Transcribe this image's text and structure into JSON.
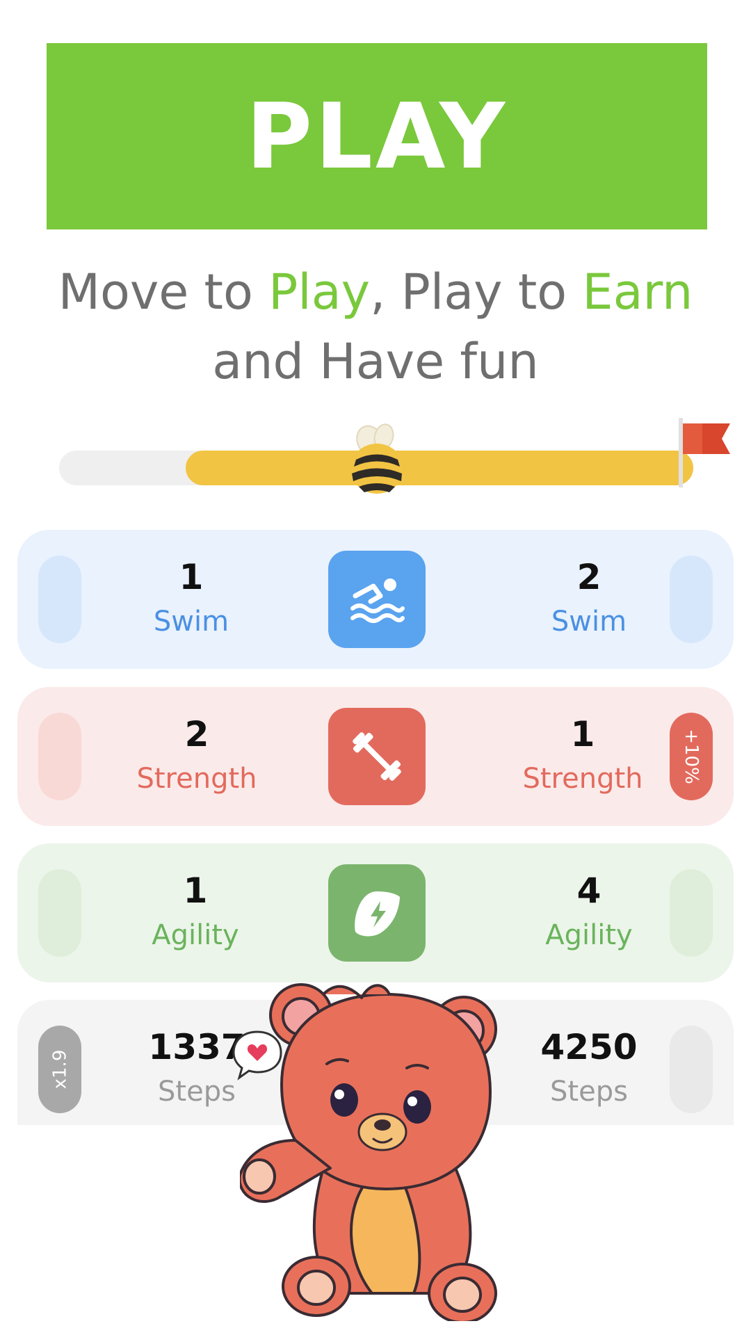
{
  "play_button": {
    "label": "PLAY"
  },
  "tagline": {
    "part1": "Move to ",
    "play": "Play",
    "part2": ", Play to ",
    "earn": "Earn",
    "line2": "and Have fun"
  },
  "progress": {
    "start_fraction": 0.2,
    "end_fraction": 1.0,
    "bee_fraction": 0.5
  },
  "colors": {
    "green": "#7ac83c",
    "swim_bg": "#e9f2fd",
    "swim_accent": "#5aa3ef",
    "swim_text": "#4a90e2",
    "strength_bg": "#fbeaea",
    "strength_accent": "#e26a5d",
    "strength_text": "#e26a5d",
    "agility_bg": "#ecf5ea",
    "agility_accent": "#7bb56d",
    "agility_text": "#6ab35c",
    "steps_bg": "#f4f4f4",
    "steps_text": "#9a9a9a"
  },
  "cards": {
    "swim": {
      "left_value": "1",
      "left_label": "Swim",
      "right_value": "2",
      "right_label": "Swim",
      "icon": "swimmer-icon"
    },
    "strength": {
      "left_value": "2",
      "left_label": "Strength",
      "right_value": "1",
      "right_label": "Strength",
      "bonus": "+10%",
      "icon": "dumbbell-icon"
    },
    "agility": {
      "left_value": "1",
      "left_label": "Agility",
      "right_value": "4",
      "right_label": "Agility",
      "icon": "leaf-bolt-icon"
    },
    "steps": {
      "left_value": "1337",
      "left_label": "Steps",
      "right_value": "4250",
      "right_label": "Steps",
      "multiplier": "x1.9",
      "icon": "heart-bubble-icon"
    }
  }
}
